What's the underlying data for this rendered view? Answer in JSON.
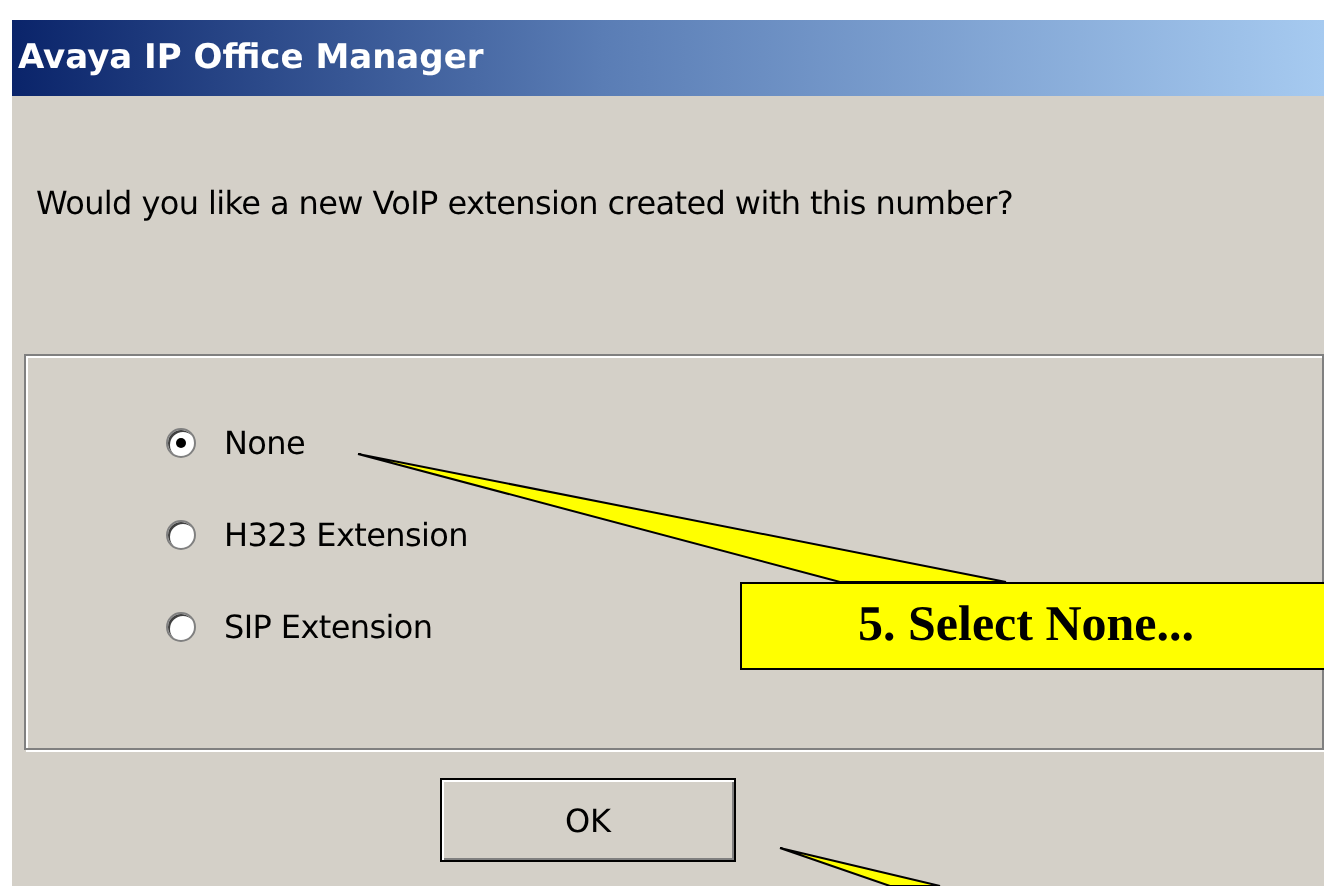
{
  "window": {
    "title": "Avaya IP Office Manager"
  },
  "message": "Would you like a new VoIP extension created with this number?",
  "options": [
    {
      "label": "None",
      "selected": true
    },
    {
      "label": "H323 Extension",
      "selected": false
    },
    {
      "label": "SIP Extension",
      "selected": false
    }
  ],
  "buttons": [
    "OK"
  ],
  "callout": {
    "text": "5. Select None..."
  }
}
